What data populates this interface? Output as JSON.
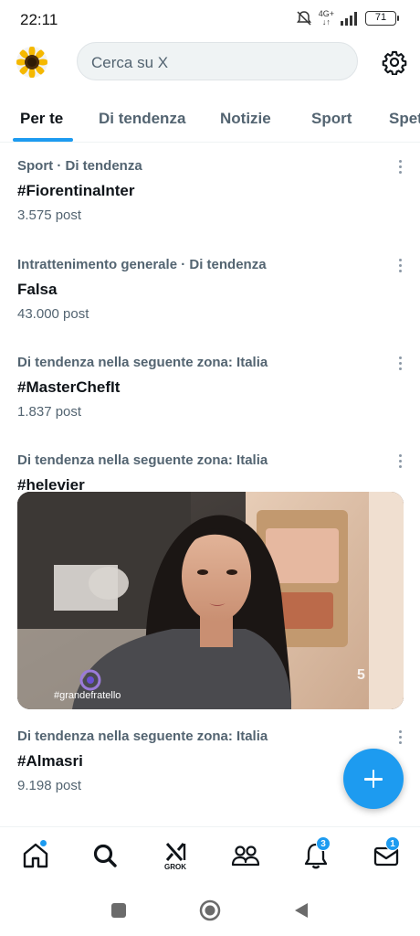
{
  "status": {
    "time": "22:11",
    "network_top": "4G+",
    "network_bottom": "↓↑",
    "battery": "71"
  },
  "search": {
    "placeholder": "Cerca su X"
  },
  "tabs": [
    {
      "label": "Per te",
      "active": true
    },
    {
      "label": "Di tendenza"
    },
    {
      "label": "Notizie"
    },
    {
      "label": "Sport"
    },
    {
      "label": "Spet"
    }
  ],
  "trends": [
    {
      "context": "Sport · Di tendenza",
      "name": "#FiorentinaInter",
      "count": "3.575 post"
    },
    {
      "context": "Intrattenimento generale · Di tendenza",
      "name": "Falsa",
      "count": "43.000 post"
    },
    {
      "context": "Di tendenza nella seguente zona: Italia",
      "name": "#MasterChefIt",
      "count": "1.837 post"
    },
    {
      "context": "Di tendenza nella seguente zona: Italia",
      "name": "#helevier",
      "count": ""
    },
    {
      "context": "Di tendenza nella seguente zona: Italia",
      "name": "#Almasri",
      "count": "9.198 post"
    }
  ],
  "media": {
    "overlay_text": "#grandefratello",
    "channel_logo": "5"
  },
  "nav": {
    "grok_label": "GROK",
    "notifications_badge": "3",
    "messages_badge": "1"
  },
  "colors": {
    "accent": "#1d9bf0",
    "text": "#0f1419",
    "secondary": "#536471"
  },
  "icons": [
    "avatar-sunflower",
    "gear-icon",
    "more-icon",
    "compose-icon",
    "home-icon",
    "search-icon",
    "grok-icon",
    "communities-icon",
    "bell-icon",
    "mail-icon"
  ]
}
